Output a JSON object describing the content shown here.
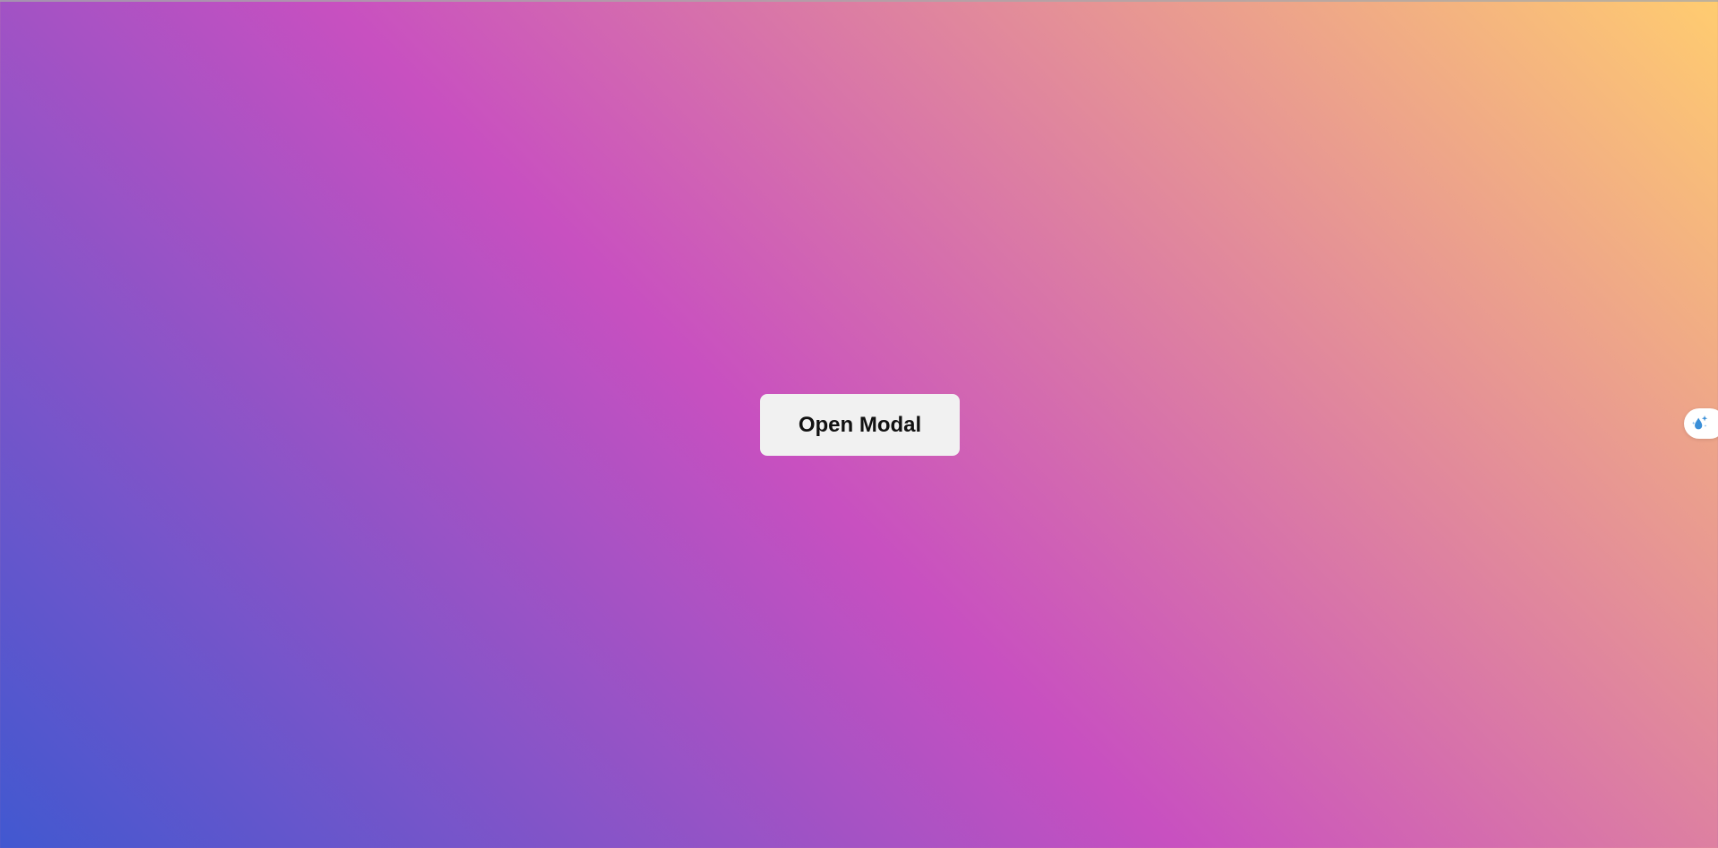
{
  "background": {
    "gradient_colors": [
      "#4158d0",
      "#c850c0",
      "#ffcc70"
    ]
  },
  "main": {
    "open_modal_label": "Open Modal"
  },
  "side_tab": {
    "icon": "water-drop-sparkle-icon",
    "accent_color": "#3a8fd8"
  }
}
